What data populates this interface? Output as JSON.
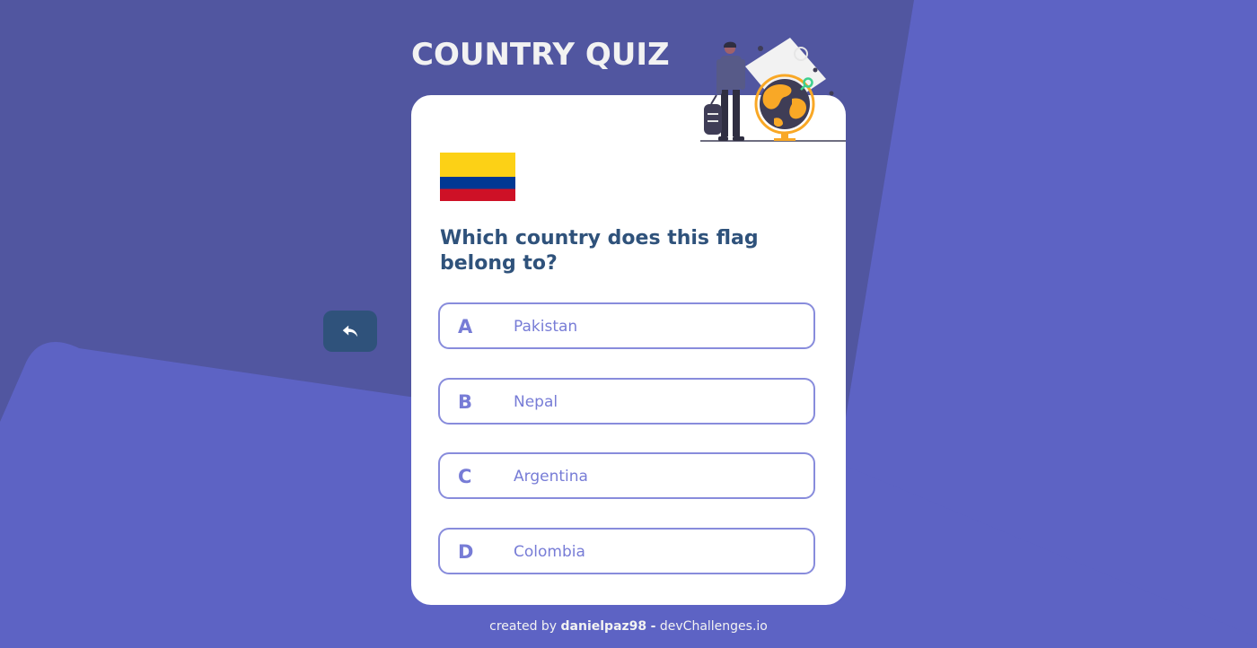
{
  "app": {
    "title": "COUNTRY QUIZ"
  },
  "colors": {
    "accent": "#6066d0",
    "question": "#2f527b",
    "background": "#5156a0",
    "flag_yellow": "#fcd116",
    "flag_blue": "#003893",
    "flag_red": "#ce1126"
  },
  "quiz": {
    "question": "Which country does this flag belong to?",
    "flag_icon": "colombia-flag-icon",
    "answers": [
      {
        "letter": "A",
        "text": "Pakistan"
      },
      {
        "letter": "B",
        "text": "Nepal"
      },
      {
        "letter": "C",
        "text": "Argentina"
      },
      {
        "letter": "D",
        "text": "Colombia"
      }
    ]
  },
  "nav": {
    "back_icon": "reply-arrow-icon"
  },
  "footer": {
    "prefix": "created by",
    "author": "danielpaz98",
    "separator": "-",
    "site": "devChallenges.io"
  }
}
